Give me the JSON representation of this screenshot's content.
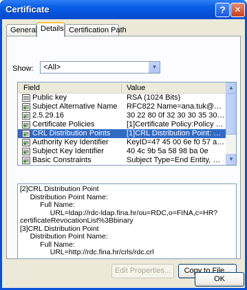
{
  "window": {
    "title": "Certificate",
    "help_glyph": "?",
    "close_glyph": "✕"
  },
  "tabs": [
    {
      "label": "General"
    },
    {
      "label": "Details"
    },
    {
      "label": "Certification Path"
    }
  ],
  "show": {
    "label": "Show:",
    "value": "<All>"
  },
  "list": {
    "columns": {
      "field": "Field",
      "value": "Value"
    },
    "rows": [
      {
        "field": "Public key",
        "value": "RSA (1024 Bits)",
        "icon": "document-icon"
      },
      {
        "field": "Subject Alternative Name",
        "value": "RFC822 Name=ana.tuk@omvi...",
        "icon": "certificate-extension-icon"
      },
      {
        "field": "2.5.29.16",
        "value": "30 22 80 0f 32 30 30 35 30 33...",
        "icon": "certificate-extension-icon"
      },
      {
        "field": "Certificate Policies",
        "value": "[1]Certificate Policy:Policy Ide...",
        "icon": "certificate-extension-icon"
      },
      {
        "field": "CRL Distribution Points",
        "value": "[1]CRL Distribution Point: Distr...",
        "icon": "certificate-extension-icon"
      },
      {
        "field": "Authority Key Identifier",
        "value": "KeyID=47 45 00 6e f0 57 a6 c0",
        "icon": "certificate-extension-icon"
      },
      {
        "field": "Subject Key Identifier",
        "value": "40 4c 9b 5a 58 98 ba 0e",
        "icon": "certificate-extension-icon"
      },
      {
        "field": "Basic Constraints",
        "value": "Subject Type=End Entity, Pat...",
        "icon": "certificate-extension-icon"
      }
    ],
    "selected_index": 4
  },
  "detail": {
    "text": "[2]CRL Distribution Point\n     Distribution Point Name:\n          Full Name:\n               URL=ldap://rdc-ldap.fina.hr/ou=RDC,o=FINA,c=HR?\ncertificateRevocationList%3Bbinary\n[3]CRL Distribution Point\n     Distribution Point Name:\n          Full Name:\n               URL=http://rdc.fina.hr/crls/rdc.crl"
  },
  "buttons": {
    "edit_properties": "Edit Properties...",
    "copy_to_file": "Copy to File...",
    "ok": "OK"
  }
}
